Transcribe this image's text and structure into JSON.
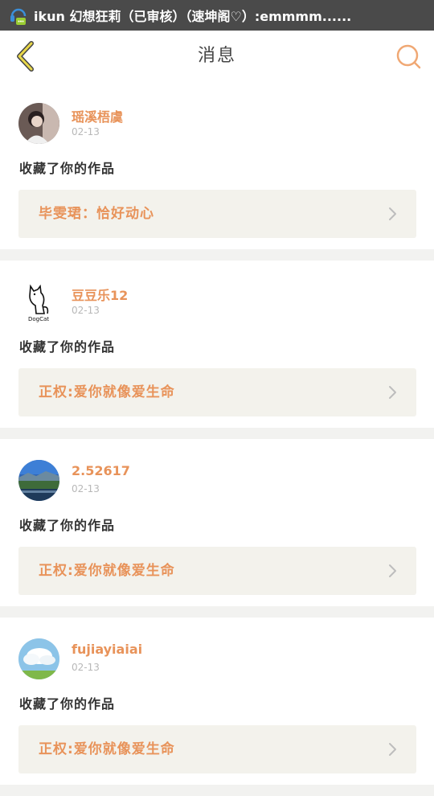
{
  "status_bar": {
    "text": "ikun 幻想狂莉（已审核）（速坤阁♡）:emmmm......"
  },
  "header": {
    "title": "消息",
    "back_icon": "chevron-left-icon",
    "search_icon": "search-icon",
    "accent_color": "#e8935a"
  },
  "messages": [
    {
      "username": "瑶溪梧虞",
      "date": "02-13",
      "action": "收藏了你的作品",
      "work_title": "毕雯珺：恰好动心",
      "avatar": "photo-avatar-girl"
    },
    {
      "username": "豆豆乐12",
      "date": "02-13",
      "action": "收藏了你的作品",
      "work_title": "正权:爱你就像爱生命",
      "avatar": "dogcat-logo-avatar"
    },
    {
      "username": "2.52617",
      "date": "02-13",
      "action": "收藏了你的作品",
      "work_title": "正权:爱你就像爱生命",
      "avatar": "landscape-avatar"
    },
    {
      "username": "fujiayiaiai",
      "date": "02-13",
      "action": "收藏了你的作品",
      "work_title": "正权:爱你就像爱生命",
      "avatar": "sky-avatar"
    }
  ],
  "avatar_logo_text": "DogCat"
}
